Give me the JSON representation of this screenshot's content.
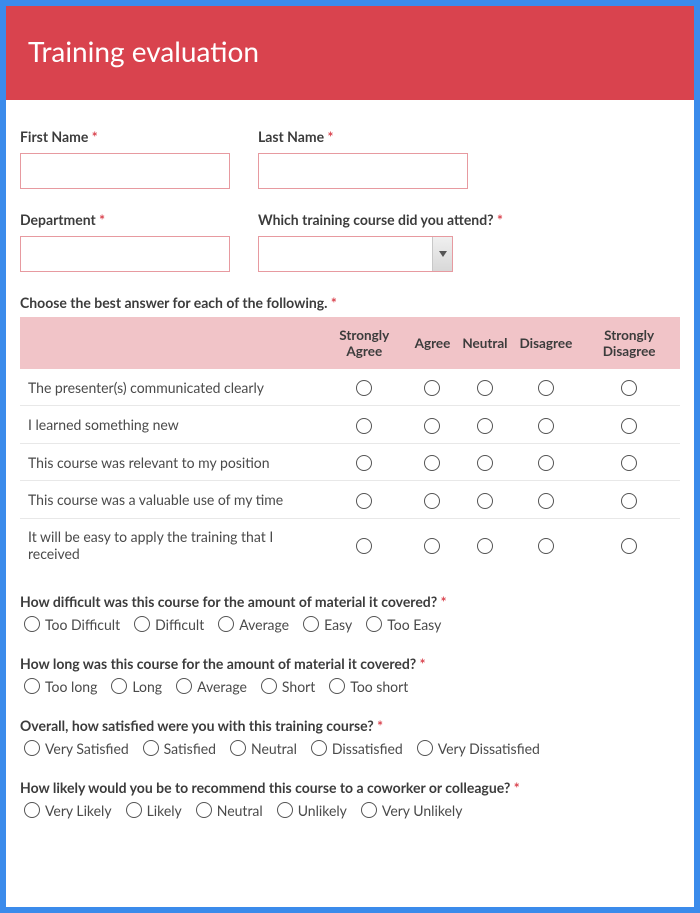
{
  "header": {
    "title": "Training evaluation"
  },
  "fields": {
    "first_name": {
      "label": "First Name",
      "value": ""
    },
    "last_name": {
      "label": "Last Name",
      "value": ""
    },
    "department": {
      "label": "Department",
      "value": ""
    },
    "course": {
      "label": "Which training course did you attend?",
      "selected": ""
    }
  },
  "matrix": {
    "label": "Choose the best answer for each of the following.",
    "columns": [
      "Strongly Agree",
      "Agree",
      "Neutral",
      "Disagree",
      "Strongly Disagree"
    ],
    "rows": [
      "The presenter(s) communicated clearly",
      "I learned something new",
      "This course was relevant to my position",
      "This course was a valuable use of my time",
      "It will be easy to apply the training that I received"
    ]
  },
  "q_difficulty": {
    "label": "How difficult was this course for the amount of material it covered?",
    "options": [
      "Too Difficult",
      "Difficult",
      "Average",
      "Easy",
      "Too Easy"
    ]
  },
  "q_length": {
    "label": "How long was this course for the amount of material it covered?",
    "options": [
      "Too long",
      "Long",
      "Average",
      "Short",
      "Too short"
    ]
  },
  "q_satisfied": {
    "label": "Overall, how satisfied were you with this training course?",
    "options": [
      "Very Satisfied",
      "Satisfied",
      "Neutral",
      "Dissatisfied",
      "Very Dissatisfied"
    ]
  },
  "q_recommend": {
    "label": "How likely would you be to recommend this course to a coworker or colleague?",
    "options": [
      "Very Likely",
      "Likely",
      "Neutral",
      "Unlikely",
      "Very Unlikely"
    ]
  }
}
